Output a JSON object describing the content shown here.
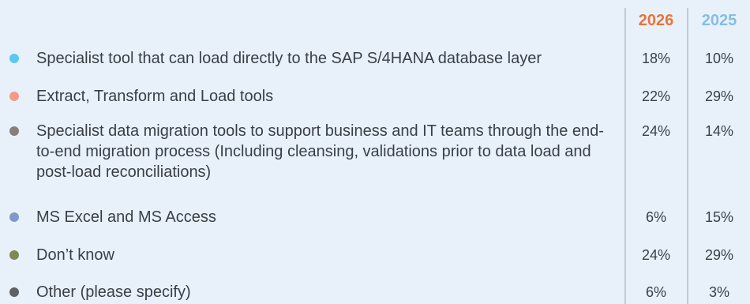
{
  "chart_data": {
    "type": "table",
    "columns": [
      {
        "label": "2026",
        "color": "#e8743a"
      },
      {
        "label": "2025",
        "color": "#86bde6"
      }
    ],
    "rows": [
      {
        "label": "Specialist tool that can load directly to the SAP S/4HANA database layer",
        "dot_color": "#5bc8f0",
        "values": [
          "18%",
          "10%"
        ]
      },
      {
        "label": "Extract, Transform and Load tools",
        "dot_color": "#f39a88",
        "values": [
          "22%",
          "29%"
        ]
      },
      {
        "label": "Specialist data migration tools to support business and IT teams through the end-to-end migration process (Including cleansing, validations prior to data load and post-load reconciliations)",
        "dot_color": "#8a7f78",
        "values": [
          "24%",
          "14%"
        ]
      },
      {
        "label": "MS Excel and MS Access",
        "dot_color": "#7f9ac8",
        "values": [
          "6%",
          "15%"
        ]
      },
      {
        "label": "Don’t know",
        "dot_color": "#7f8a52",
        "values": [
          "24%",
          "29%"
        ]
      },
      {
        "label": "Other (please specify)",
        "dot_color": "#5e6166",
        "values": [
          "6%",
          "3%"
        ]
      }
    ]
  }
}
